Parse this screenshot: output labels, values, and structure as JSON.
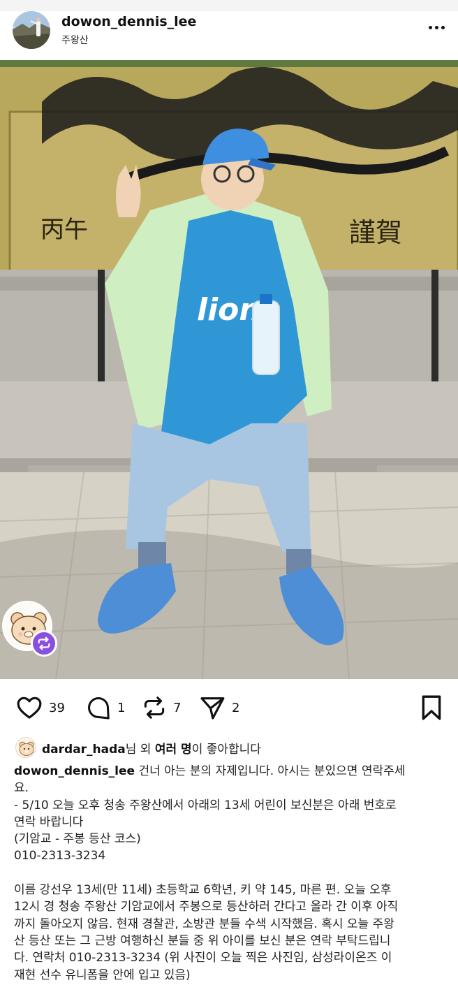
{
  "post": {
    "username": "dowon_dennis_lee",
    "location": "주왕산",
    "stats": {
      "likes": "39",
      "comments": "1",
      "reposts": "7",
      "shares": "2"
    },
    "liked_by_user": "dardar_hada",
    "liked_by_suffix_1": "님 외 ",
    "liked_by_bold": "여러 명",
    "liked_by_suffix_2": "이 좋아합니다",
    "caption_author": "dowon_dennis_lee",
    "caption_text": " 건너 아는 분의 자제입니다. 아시는 분있으면 연락주세\n요.\n- 5/10 오늘 오후 청송 주왕산에서 아래의 13세 어린이 보신분은 아래 번호로\n연락 바랍니다\n(기암교 - 주봉 등산 코스)\n010-2313-3234\n\n이름 강선우 13세(만 11세) 초등학교 6학년, 키 약 145, 마른 편. 오늘 오후\n12시 경 청송 주왕산 기암교에서 주봉으로 등산하러 간다고 올라 간 이후 아직\n까지 돌아오지 않음. 현재 경찰관, 소방관 분들 수색 시작했음. 혹시 오늘 주왕\n산 등산 또는 그 근방 여행하신 분들 중 위 아이를 보신 분은 연락 부탁드립니\n다. 연락처 010-2313-3234 (위 사진이 오늘 찍은 사진임, 삼성라이온즈 이\n재현 선수 유니폼을 안에 입고 있음)"
  },
  "icons": {
    "like": "heart-icon",
    "comment": "comment-icon",
    "repost": "repost-icon",
    "share": "send-icon",
    "save": "bookmark-icon",
    "more": "more-icon"
  },
  "colors": {
    "repost_badge": "#8a4fe0",
    "text": "#111111"
  }
}
